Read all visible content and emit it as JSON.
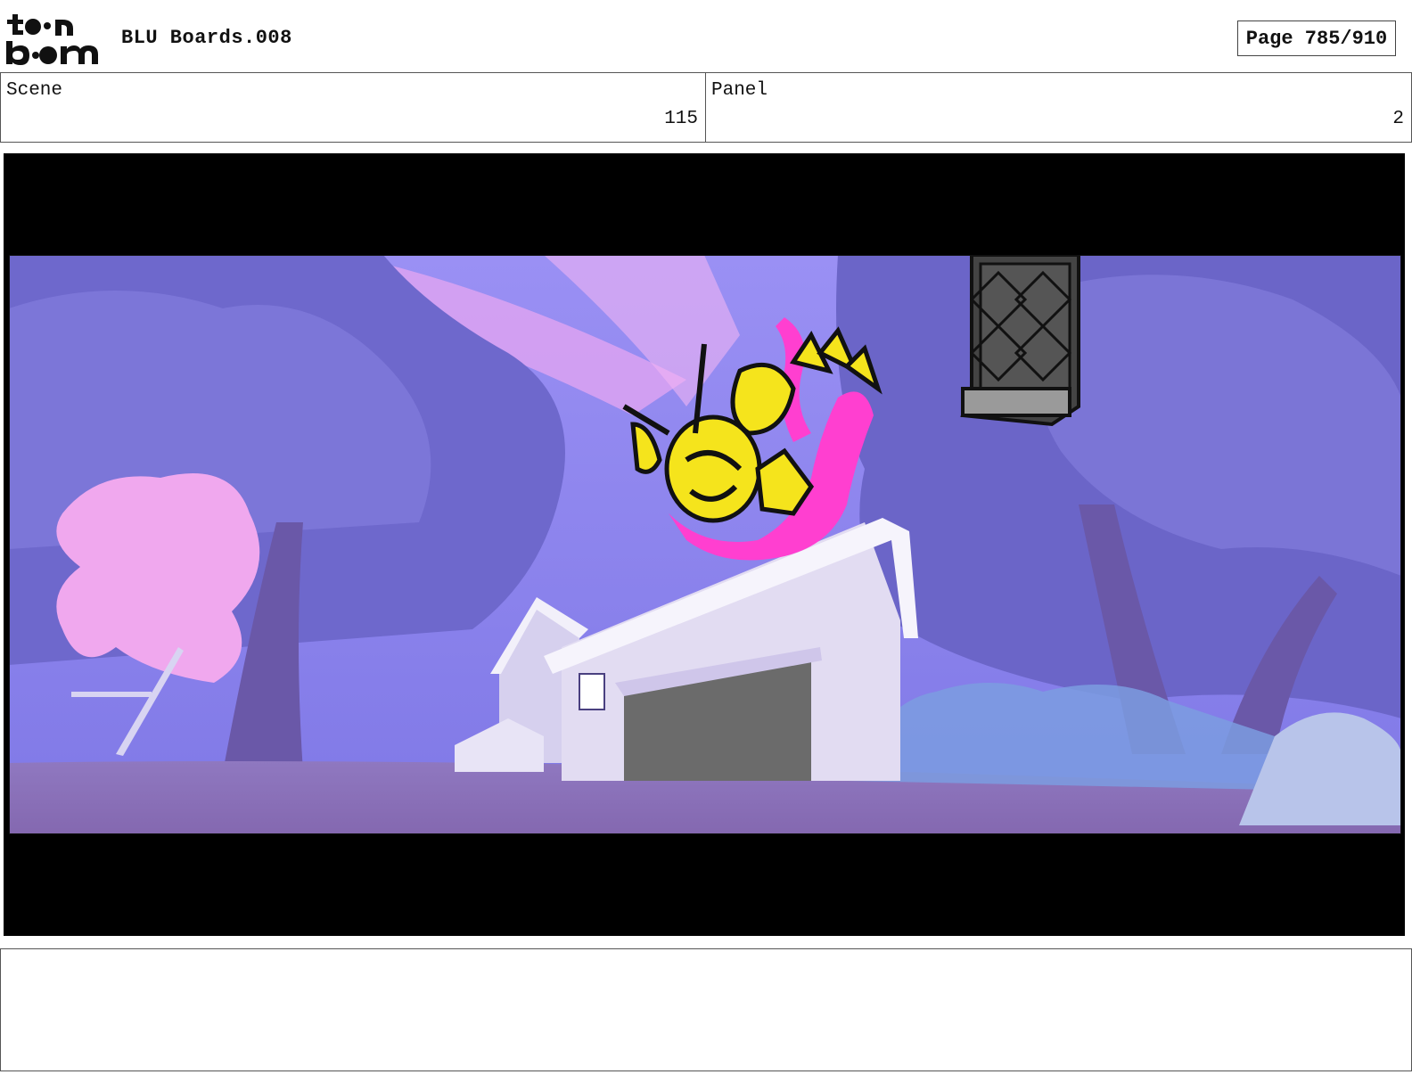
{
  "header": {
    "logo": {
      "icon": "toonboom-logo",
      "text_top": "to•n",
      "text_bottom": "b••m"
    },
    "document_title": "BLU Boards.008",
    "page_label": "Page 785/910"
  },
  "info": {
    "scene_label": "Scene",
    "scene_value": "115",
    "panel_label": "Panel",
    "panel_value": "2"
  },
  "panel_image": {
    "icon": "storyboard-panel-image",
    "colors": {
      "letterbox": "#000000",
      "sky": "#8b85f0",
      "foliage": "#6a64c4",
      "ground": "#8a70b8",
      "splash": "#ff3fd0",
      "character": "#f5e41c",
      "garage_door": "#6b6b6b"
    }
  },
  "notes": {
    "text": ""
  }
}
